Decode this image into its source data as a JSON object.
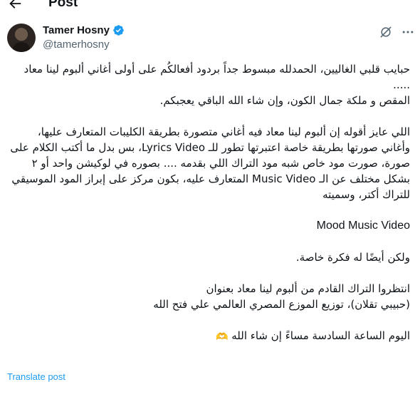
{
  "header": {
    "title": "Post",
    "back_icon": "arrow-left-icon"
  },
  "author": {
    "name": "Tamer Hosny",
    "handle": "@tamerhosny",
    "verified": true,
    "avatar_icon": "avatar",
    "grok_icon": "grok-icon",
    "more_icon": "more-horizontal-icon"
  },
  "tweet": {
    "p1": "حبايب قلبي الغاليين، الحمدلله مبسوط جداً بردود أفعالكُم على أولى أغاني ألبوم لينا معاد .....\nالمقص و ملكة جمال الكون، وإن شاء الله الباقي يعجبكم.",
    "p2": "اللي عايز أقوله إن ألبوم لينا معاد فيه أغاني متصورة بطريقة الكليبات المتعارف عليها، وأغاني صورتها بطريقة خاصة اعتبرتها تطور للـ Lyrics Video، بس بدل ما أكتب الكلام على صورة، صورت مود خاص شبه مود التراك اللي بقدمه .... بصوره في لوكيشن واحد أو ٢ بشكل مختلف عن الـ Music Video المتعارف عليه، بكون مركز على إبراز المود الموسيقي للتراك أكتر، وسميته",
    "p3": "Mood Music Video",
    "p4": "ولكن أيضًا له فكرة خاصة.",
    "p5": "انتظروا التراك القادم من ألبوم لينا معاد بعنوان\n(حبيبي تقلان)، توزيع الموزع المصري العالمي علي فتح الله",
    "p6": "اليوم الساعة السادسة مساءً إن شاء الله",
    "p6_emoji": "🫶"
  },
  "translate_label": "Translate post",
  "colors": {
    "accent": "#1d9bf0",
    "text": "#0f1419",
    "muted": "#536471",
    "emoji": "#f5c242"
  }
}
